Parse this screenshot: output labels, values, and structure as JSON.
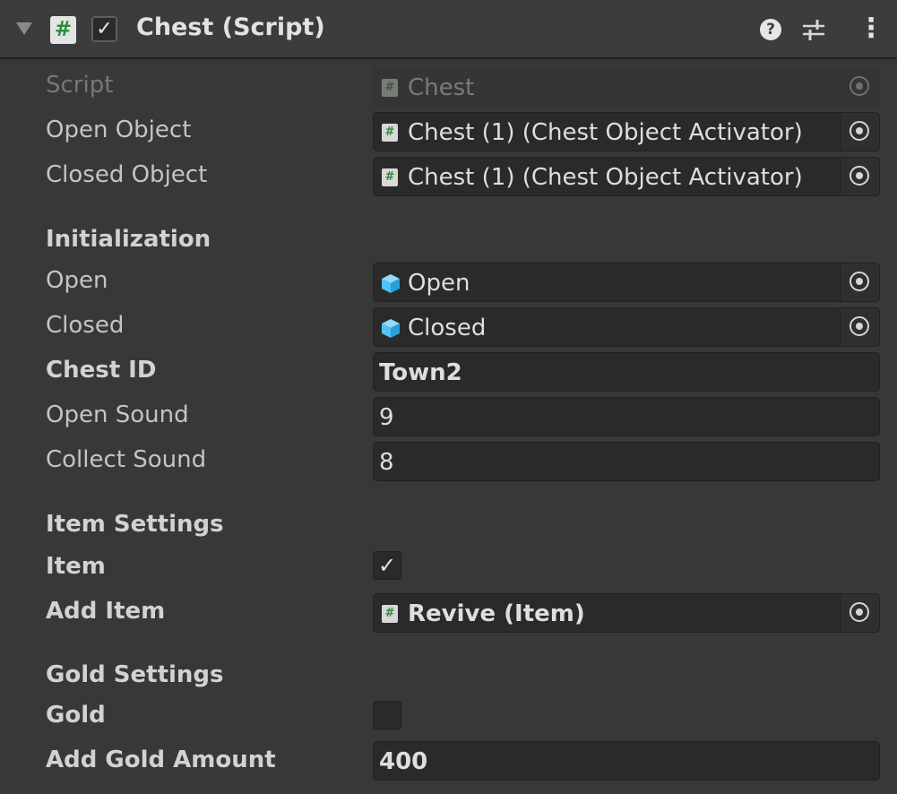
{
  "header": {
    "title": "Chest (Script)",
    "enabled": true,
    "icons": [
      "fold-arrow-icon",
      "script-icon",
      "help-icon",
      "preset-icon",
      "more-menu-icon"
    ]
  },
  "fields": {
    "script": {
      "label": "Script",
      "value": "Chest"
    },
    "open_object": {
      "label": "Open Object",
      "value": "Chest (1) (Chest Object Activator)"
    },
    "closed_object": {
      "label": "Closed Object",
      "value": "Chest (1) (Chest Object Activator)"
    },
    "initialization_header": "Initialization",
    "open": {
      "label": "Open",
      "value": "Open"
    },
    "closed": {
      "label": "Closed",
      "value": "Closed"
    },
    "chest_id": {
      "label": "Chest ID",
      "value": "Town2"
    },
    "open_sound": {
      "label": "Open Sound",
      "value": "9"
    },
    "collect_sound": {
      "label": "Collect Sound",
      "value": "8"
    },
    "item_settings_header": "Item Settings",
    "item": {
      "label": "Item",
      "checked": true
    },
    "add_item": {
      "label": "Add Item",
      "value": "Revive (Item)"
    },
    "gold_settings_header": "Gold Settings",
    "gold": {
      "label": "Gold",
      "checked": false
    },
    "add_gold_amount": {
      "label": "Add Gold Amount",
      "value": "400"
    }
  },
  "glyphs": {
    "hash": "#",
    "check": "✓",
    "question": "?",
    "more": "⋮"
  },
  "colors": {
    "background": "#383838",
    "field": "#2a2a2a",
    "script_icon_green": "#2e8b3a",
    "cube_blue": "#4fc3f7"
  }
}
